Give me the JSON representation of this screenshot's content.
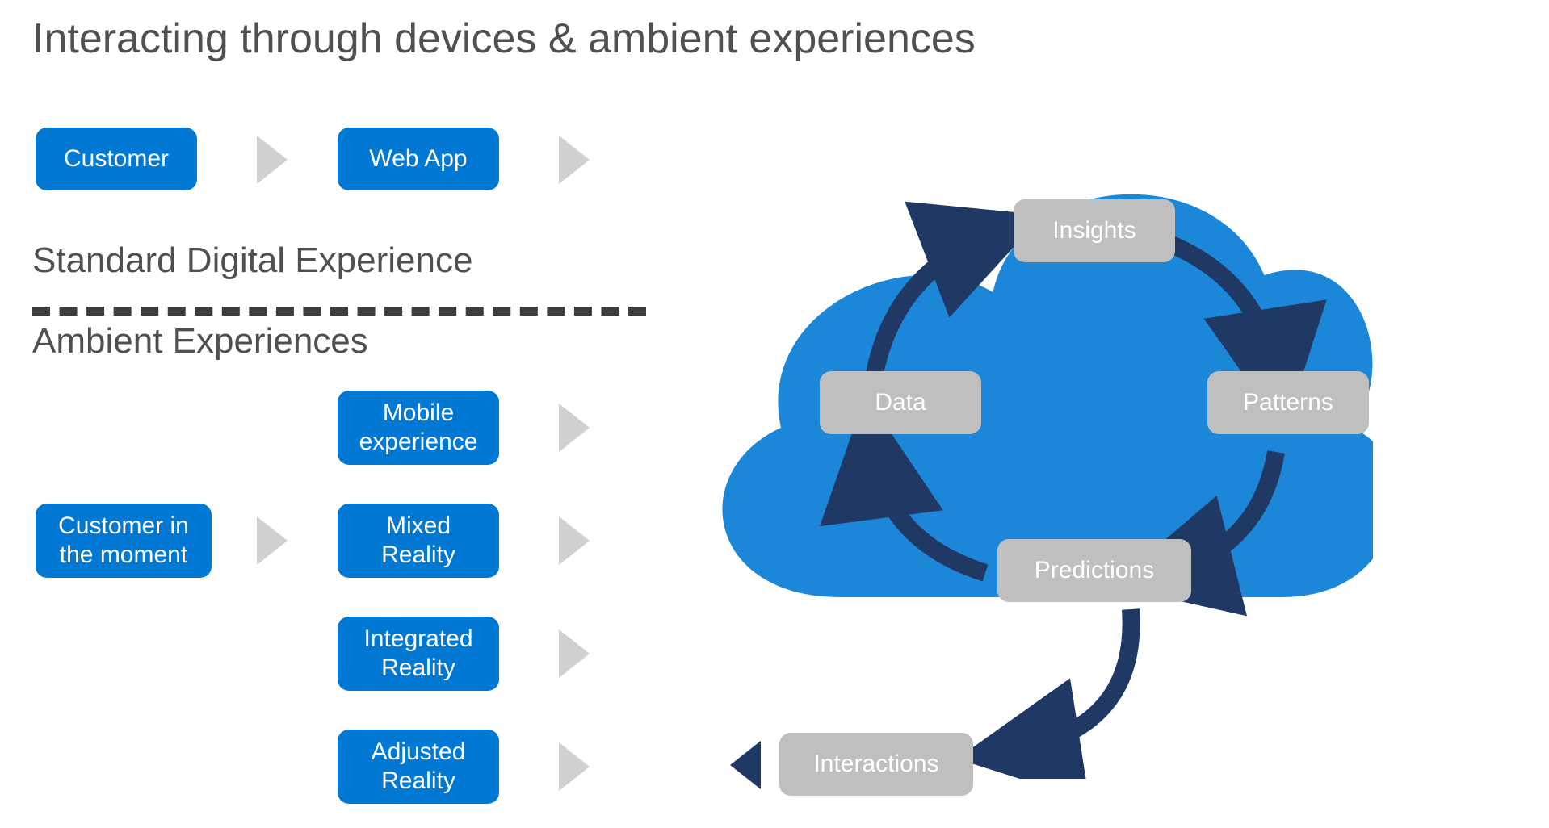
{
  "title": "Interacting through devices & ambient experiences",
  "standard": {
    "heading": "Standard Digital Experience",
    "customer": "Customer",
    "webapp": "Web App"
  },
  "ambient": {
    "heading": "Ambient Experiences",
    "customer": "Customer in the moment",
    "channels": [
      "Mobile experience",
      "Mixed Reality",
      "Integrated Reality",
      "Adjusted Reality"
    ]
  },
  "cloud": {
    "insights": "Insights",
    "patterns": "Patterns",
    "predictions": "Predictions",
    "data": "Data",
    "interactions": "Interactions"
  },
  "colors": {
    "blue": "#0078d4",
    "cloudBlue": "#1c87d8",
    "grey": "#bfbfbf",
    "navy": "#1f3864",
    "arrowGrey": "#d0d0d0"
  }
}
